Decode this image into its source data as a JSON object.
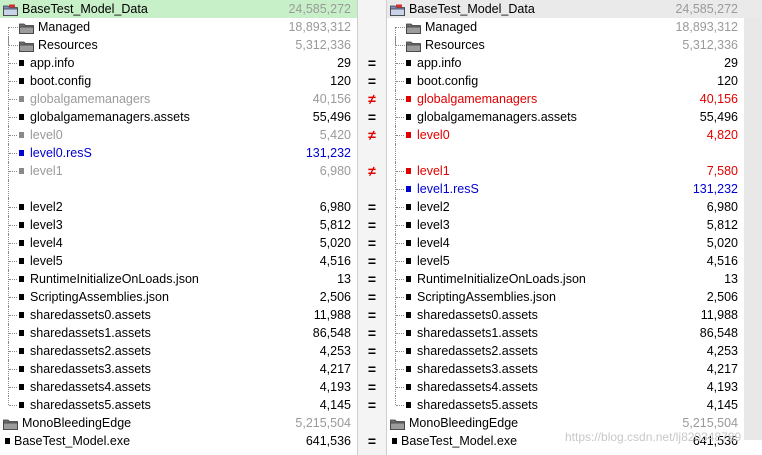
{
  "left": {
    "rows": [
      {
        "name": "BaseTest_Model_Data",
        "size": "24,585,272",
        "kind": "root",
        "color": "",
        "size_color": "grey",
        "highlight": "green"
      },
      {
        "name": "Managed",
        "size": "18,893,312",
        "kind": "folder",
        "color": "",
        "size_color": "grey"
      },
      {
        "name": "Resources",
        "size": "5,312,336",
        "kind": "folder",
        "color": "",
        "size_color": "grey"
      },
      {
        "name": "app.info",
        "size": "29",
        "kind": "file",
        "color": ""
      },
      {
        "name": "boot.config",
        "size": "120",
        "kind": "file",
        "color": ""
      },
      {
        "name": "globalgamemanagers",
        "size": "40,156",
        "kind": "file",
        "color": "grey"
      },
      {
        "name": "globalgamemanagers.assets",
        "size": "55,496",
        "kind": "file",
        "color": ""
      },
      {
        "name": "level0",
        "size": "5,420",
        "kind": "file",
        "color": "grey"
      },
      {
        "name": "level0.resS",
        "size": "131,232",
        "kind": "file",
        "color": "blue"
      },
      {
        "name": "level1",
        "size": "6,980",
        "kind": "file",
        "color": "grey"
      },
      {
        "name": "",
        "size": "",
        "kind": "blank",
        "color": ""
      },
      {
        "name": "level2",
        "size": "6,980",
        "kind": "file",
        "color": ""
      },
      {
        "name": "level3",
        "size": "5,812",
        "kind": "file",
        "color": ""
      },
      {
        "name": "level4",
        "size": "5,020",
        "kind": "file",
        "color": ""
      },
      {
        "name": "level5",
        "size": "4,516",
        "kind": "file",
        "color": ""
      },
      {
        "name": "RuntimeInitializeOnLoads.json",
        "size": "13",
        "kind": "file",
        "color": ""
      },
      {
        "name": "ScriptingAssemblies.json",
        "size": "2,506",
        "kind": "file",
        "color": ""
      },
      {
        "name": "sharedassets0.assets",
        "size": "11,988",
        "kind": "file",
        "color": ""
      },
      {
        "name": "sharedassets1.assets",
        "size": "86,548",
        "kind": "file",
        "color": ""
      },
      {
        "name": "sharedassets2.assets",
        "size": "4,253",
        "kind": "file",
        "color": ""
      },
      {
        "name": "sharedassets3.assets",
        "size": "4,217",
        "kind": "file",
        "color": ""
      },
      {
        "name": "sharedassets4.assets",
        "size": "4,193",
        "kind": "file",
        "color": ""
      },
      {
        "name": "sharedassets5.assets",
        "size": "4,145",
        "kind": "file",
        "last": true,
        "color": ""
      },
      {
        "name": "MonoBleedingEdge",
        "size": "5,215,504",
        "kind": "topfolder",
        "color": "",
        "size_color": "grey"
      },
      {
        "name": "BaseTest_Model.exe",
        "size": "641,536",
        "kind": "topfile",
        "color": ""
      }
    ]
  },
  "right": {
    "rows": [
      {
        "name": "BaseTest_Model_Data",
        "size": "24,585,272",
        "kind": "root",
        "color": "",
        "size_color": "grey",
        "highlight": "grey"
      },
      {
        "name": "Managed",
        "size": "18,893,312",
        "kind": "folder",
        "color": "",
        "size_color": "grey"
      },
      {
        "name": "Resources",
        "size": "5,312,336",
        "kind": "folder",
        "color": "",
        "size_color": "grey"
      },
      {
        "name": "app.info",
        "size": "29",
        "kind": "file",
        "color": ""
      },
      {
        "name": "boot.config",
        "size": "120",
        "kind": "file",
        "color": ""
      },
      {
        "name": "globalgamemanagers",
        "size": "40,156",
        "kind": "file",
        "color": "red"
      },
      {
        "name": "globalgamemanagers.assets",
        "size": "55,496",
        "kind": "file",
        "color": ""
      },
      {
        "name": "level0",
        "size": "4,820",
        "kind": "file",
        "color": "red"
      },
      {
        "name": "",
        "size": "",
        "kind": "blank",
        "color": ""
      },
      {
        "name": "level1",
        "size": "7,580",
        "kind": "file",
        "color": "red"
      },
      {
        "name": "level1.resS",
        "size": "131,232",
        "kind": "file",
        "color": "blue"
      },
      {
        "name": "level2",
        "size": "6,980",
        "kind": "file",
        "color": ""
      },
      {
        "name": "level3",
        "size": "5,812",
        "kind": "file",
        "color": ""
      },
      {
        "name": "level4",
        "size": "5,020",
        "kind": "file",
        "color": ""
      },
      {
        "name": "level5",
        "size": "4,516",
        "kind": "file",
        "color": ""
      },
      {
        "name": "RuntimeInitializeOnLoads.json",
        "size": "13",
        "kind": "file",
        "color": ""
      },
      {
        "name": "ScriptingAssemblies.json",
        "size": "2,506",
        "kind": "file",
        "color": ""
      },
      {
        "name": "sharedassets0.assets",
        "size": "11,988",
        "kind": "file",
        "color": ""
      },
      {
        "name": "sharedassets1.assets",
        "size": "86,548",
        "kind": "file",
        "color": ""
      },
      {
        "name": "sharedassets2.assets",
        "size": "4,253",
        "kind": "file",
        "color": ""
      },
      {
        "name": "sharedassets3.assets",
        "size": "4,217",
        "kind": "file",
        "color": ""
      },
      {
        "name": "sharedassets4.assets",
        "size": "4,193",
        "kind": "file",
        "color": ""
      },
      {
        "name": "sharedassets5.assets",
        "size": "4,145",
        "kind": "file",
        "last": true,
        "color": ""
      },
      {
        "name": "MonoBleedingEdge",
        "size": "5,215,504",
        "kind": "topfolder",
        "color": "",
        "size_color": "grey"
      },
      {
        "name": "BaseTest_Model.exe",
        "size": "641,536",
        "kind": "topfile",
        "color": ""
      }
    ]
  },
  "gutter": [
    "",
    "",
    "",
    "=",
    "=",
    "≠",
    "=",
    "≠",
    "",
    "≠",
    "",
    "=",
    "=",
    "=",
    "=",
    "=",
    "=",
    "=",
    "=",
    "=",
    "=",
    "=",
    "=",
    "",
    "="
  ],
  "watermark": "https://blog.csdn.net/lj820348789",
  "colors": {
    "match_highlight": "#c8f0c8",
    "diff_red": "#e00000",
    "orphan_blue": "#0000d0",
    "muted_grey": "#9a9a9a"
  }
}
